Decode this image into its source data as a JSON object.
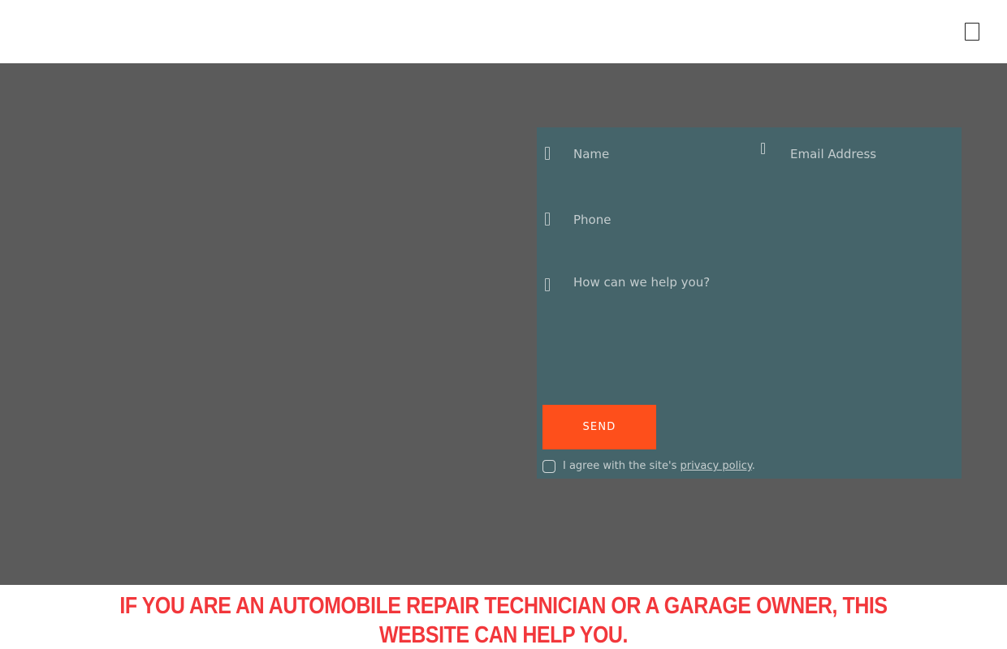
{
  "form": {
    "name_placeholder": "Name",
    "email_placeholder": "Email Address",
    "phone_placeholder": "Phone",
    "message_placeholder": "How can we help you?",
    "send_label": "SEND",
    "consent_prefix": "I agree with the site's ",
    "consent_link": "privacy policy",
    "consent_suffix": "."
  },
  "headline": {
    "text": "IF YOU ARE AN AUTOMOBILE REPAIR TECHNICIAN OR A GARAGE OWNER, THIS WEBSITE CAN HELP YOU."
  },
  "icons": {
    "menu": "hamburger-menu-icon",
    "name": "user-icon",
    "email": "envelope-icon",
    "phone": "phone-icon",
    "message": "comment-icon"
  },
  "colors": {
    "accent": "#fe4f1b",
    "headline": "#f2373b",
    "overlay": "#5b5b5b",
    "panel": "#45646a"
  }
}
